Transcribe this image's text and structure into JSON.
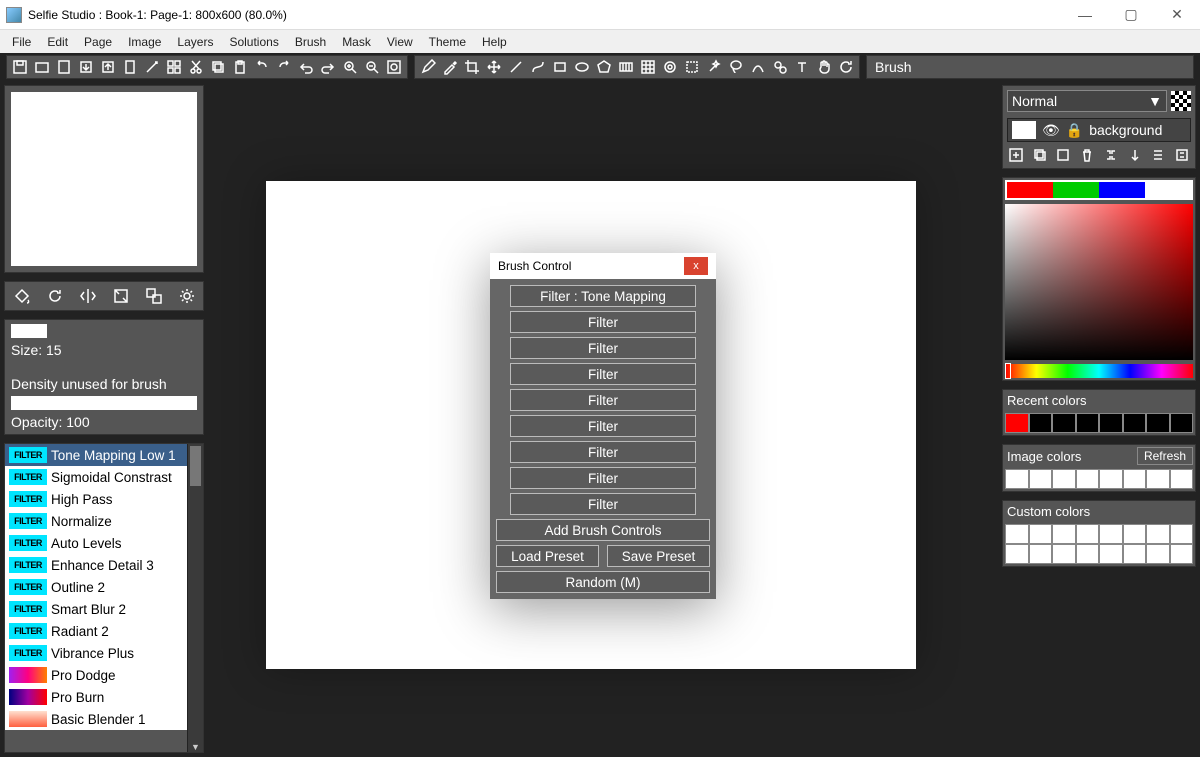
{
  "window": {
    "title": "Selfie Studio : Book-1: Page-1: 800x600  (80.0%)",
    "min": "—",
    "max": "▢",
    "close": "✕"
  },
  "menu": [
    "File",
    "Edit",
    "Page",
    "Image",
    "Layers",
    "Solutions",
    "Brush",
    "Mask",
    "View",
    "Theme",
    "Help"
  ],
  "brush_bar_label": "Brush",
  "props": {
    "size_label": "Size: 15",
    "density_label": "Density unused for brush",
    "opacity_label": "Opacity: 100"
  },
  "filters": [
    {
      "label": "Tone Mapping Low 1",
      "badge": "FILTER",
      "sel": true,
      "style": ""
    },
    {
      "label": "Sigmoidal Constrast",
      "badge": "FILTER",
      "sel": false,
      "style": ""
    },
    {
      "label": "High Pass",
      "badge": "FILTER",
      "sel": false,
      "style": ""
    },
    {
      "label": "Normalize",
      "badge": "FILTER",
      "sel": false,
      "style": ""
    },
    {
      "label": "Auto Levels",
      "badge": "FILTER",
      "sel": false,
      "style": ""
    },
    {
      "label": "Enhance Detail 3",
      "badge": "FILTER",
      "sel": false,
      "style": ""
    },
    {
      "label": "Outline 2",
      "badge": "FILTER",
      "sel": false,
      "style": ""
    },
    {
      "label": "Smart Blur 2",
      "badge": "FILTER",
      "sel": false,
      "style": ""
    },
    {
      "label": "Radiant 2",
      "badge": "FILTER",
      "sel": false,
      "style": ""
    },
    {
      "label": "Vibrance Plus",
      "badge": "FILTER",
      "sel": false,
      "style": ""
    },
    {
      "label": "Pro Dodge",
      "badge": "",
      "sel": false,
      "style": "grad1"
    },
    {
      "label": "Pro Burn",
      "badge": "",
      "sel": false,
      "style": "grad2"
    },
    {
      "label": "Basic Blender 1",
      "badge": "",
      "sel": false,
      "style": "grad3"
    }
  ],
  "dialog": {
    "title": "Brush Control",
    "buttons": [
      "Filter : Tone Mapping",
      "Filter",
      "Filter",
      "Filter",
      "Filter",
      "Filter",
      "Filter",
      "Filter",
      "Filter"
    ],
    "add": "Add Brush Controls",
    "load": "Load Preset",
    "save": "Save Preset",
    "random": "Random (M)"
  },
  "layers": {
    "blend_mode": "Normal",
    "layer_name": "background"
  },
  "colors": {
    "primary": [
      "#ff0000",
      "#00cc00",
      "#0000ff",
      "#ffffff"
    ],
    "recent_label": "Recent colors",
    "recent": [
      "#ff0000",
      "#000000",
      "#000000",
      "#000000",
      "#000000",
      "#000000",
      "#000000",
      "#000000"
    ],
    "image_label": "Image colors",
    "refresh": "Refresh",
    "image": [
      "#ffffff",
      "#ffffff",
      "#ffffff",
      "#ffffff",
      "#ffffff",
      "#ffffff",
      "#ffffff",
      "#ffffff"
    ],
    "custom_label": "Custom colors"
  }
}
